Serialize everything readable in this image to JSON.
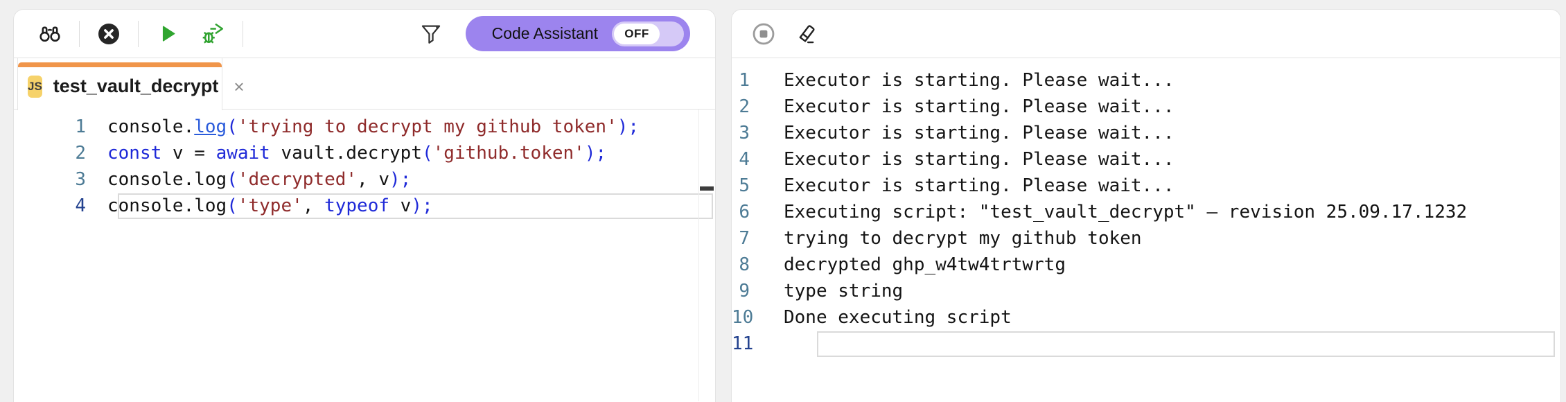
{
  "colors": {
    "page_bg": "#f0f0f0",
    "accent_orange": "#f0954a",
    "assistant_purple": "#9c84ee",
    "toggle_track": "#d5c9f7",
    "run_green": "#2fa52f",
    "keyword_blue": "#1f2ad8",
    "string_red": "#8f2b2b",
    "line_number_teal": "#4d7b95",
    "active_line_number": "#22418e"
  },
  "icons": {
    "search": "binoculars-icon",
    "stop_script": "x-circle-icon",
    "run": "play-icon",
    "debug": "bug-arrow-icon",
    "filter": "funnel-icon",
    "stop_output": "stop-circle-icon",
    "clear_output": "eraser-icon",
    "tab_close": "close-x-icon"
  },
  "left_panel": {
    "code_assistant": {
      "label": "Code Assistant",
      "state": "OFF"
    },
    "tab": {
      "badge": "JS",
      "title": "test_vault_decrypt",
      "close": "×"
    },
    "editor": {
      "active_line": "4",
      "lines": [
        {
          "n": "1",
          "tokens": [
            [
              "pl",
              "console."
            ],
            [
              "ln",
              "log"
            ],
            [
              "pu",
              "("
            ],
            [
              "str",
              "'trying to decrypt my github token'"
            ],
            [
              "pu",
              ");"
            ]
          ]
        },
        {
          "n": "2",
          "tokens": [
            [
              "kw",
              "const"
            ],
            [
              "pl",
              " v = "
            ],
            [
              "kw",
              "await"
            ],
            [
              "pl",
              " vault.decrypt"
            ],
            [
              "pu",
              "("
            ],
            [
              "str",
              "'github.token'"
            ],
            [
              "pu",
              ");"
            ]
          ]
        },
        {
          "n": "3",
          "tokens": [
            [
              "pl",
              "console.log"
            ],
            [
              "pu",
              "("
            ],
            [
              "str",
              "'decrypted'"
            ],
            [
              "pl",
              ", v"
            ],
            [
              "pu",
              ");"
            ]
          ]
        },
        {
          "n": "4",
          "tokens": [
            [
              "pl",
              "console.log"
            ],
            [
              "pu",
              "("
            ],
            [
              "str",
              "'type'"
            ],
            [
              "pl",
              ", "
            ],
            [
              "kw",
              "typeof"
            ],
            [
              "pl",
              " v"
            ],
            [
              "pu",
              ");"
            ]
          ]
        }
      ]
    }
  },
  "right_panel": {
    "console": {
      "active_line": "11",
      "lines": [
        {
          "n": "1",
          "text": "Executor is starting. Please wait..."
        },
        {
          "n": "2",
          "text": "Executor is starting. Please wait..."
        },
        {
          "n": "3",
          "text": "Executor is starting. Please wait..."
        },
        {
          "n": "4",
          "text": "Executor is starting. Please wait..."
        },
        {
          "n": "5",
          "text": "Executor is starting. Please wait..."
        },
        {
          "n": "6",
          "text": "Executing script: \"test_vault_decrypt\" – revision 25.09.17.1232"
        },
        {
          "n": "7",
          "text": "trying to decrypt my github token"
        },
        {
          "n": "8",
          "text": "decrypted ghp_w4tw4trtwrtg"
        },
        {
          "n": "9",
          "text": "type string"
        },
        {
          "n": "10",
          "text": "Done executing script"
        },
        {
          "n": "11",
          "text": ""
        }
      ]
    }
  }
}
